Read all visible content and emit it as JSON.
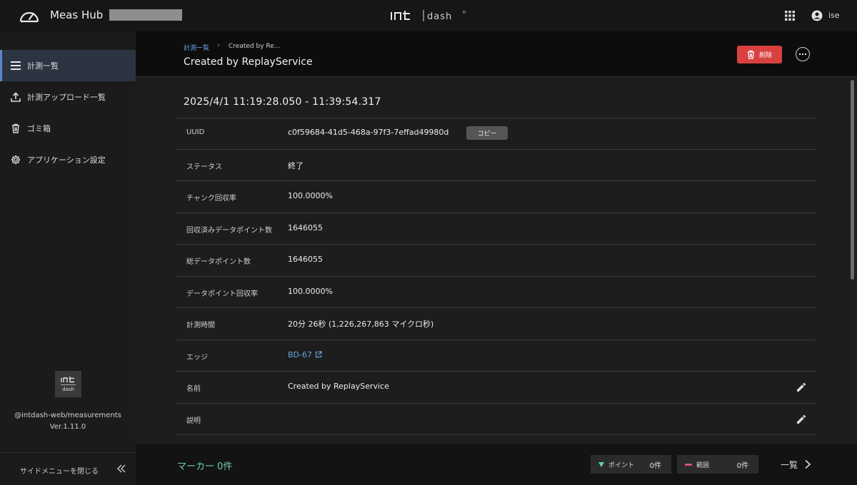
{
  "topbar": {
    "app_title": "Meas Hub",
    "brand": "intdash",
    "user_name": "ise"
  },
  "sidebar": {
    "items": [
      {
        "label": "計測一覧",
        "icon": "menu-icon",
        "active": true
      },
      {
        "label": "計測アップロード一覧",
        "icon": "upload-icon",
        "active": false
      },
      {
        "label": "ゴミ箱",
        "icon": "trash-icon",
        "active": false
      },
      {
        "label": "アプリケーション設定",
        "icon": "gear-icon",
        "active": false
      }
    ],
    "package": "@intdash-web/measurements",
    "version": "Ver.1.11.0",
    "close_label": "サイドメニューを閉じる"
  },
  "header": {
    "breadcrumb_link": "計測一覧",
    "breadcrumb_sep": "›",
    "breadcrumb_current": "Created by Re...",
    "title": "Created by ReplayService",
    "delete_label": "削除"
  },
  "detail": {
    "range": "2025/4/1 11:19:28.050 - 11:39:54.317",
    "rows": [
      {
        "key": "UUID",
        "value": "c0f59684-41d5-468a-97f3-7effad49980d",
        "copy_label": "コピー"
      },
      {
        "key": "ステータス",
        "value": "終了"
      },
      {
        "key": "チャンク回収率",
        "value": "100.0000%"
      },
      {
        "key": "回収済みデータポイント数",
        "value": "1646055"
      },
      {
        "key": "総データポイント数",
        "value": "1646055"
      },
      {
        "key": "データポイント回収率",
        "value": "100.0000%"
      },
      {
        "key": "計測時間",
        "value": "20分 26秒 (1,226,267,863 マイクロ秒)"
      },
      {
        "key": "エッジ",
        "value": "BD-67"
      },
      {
        "key": "名前",
        "value": "Created by ReplayService"
      },
      {
        "key": "説明",
        "value": ""
      }
    ]
  },
  "markers": {
    "label": "マーカー 0件",
    "point_label": "ポイント",
    "point_count": "0件",
    "range_label": "範囲",
    "range_count": "0件",
    "list_label": "一覧"
  },
  "colors": {
    "accent_blue": "#6aa4e0",
    "delete_red": "#d9413f",
    "marker_green": "#6fd0a8",
    "point_teal": "#5fd3b3",
    "range_pink": "#e0507a"
  }
}
